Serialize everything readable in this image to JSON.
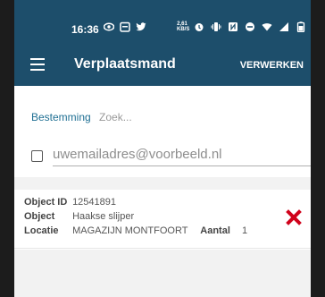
{
  "status_bar": {
    "time": "16:36",
    "network_speed": "2,61"
  },
  "app_bar": {
    "title": "Verplaatsmand",
    "process_label": "VERWERKEN",
    "menu_icon": "hamburger-menu-icon"
  },
  "destination": {
    "label": "Bestemming",
    "search_placeholder": "Zoek..."
  },
  "email": {
    "placeholder": "uwemailadres@voorbeeld.nl",
    "checked": false
  },
  "items": [
    {
      "object_id_label": "Object ID",
      "object_id": "12541891",
      "object_label": "Object",
      "object": "Haakse slijper",
      "location_label": "Locatie",
      "location": "MAGAZIJN MONTFOORT",
      "count_label": "Aantal",
      "count": "1"
    }
  ],
  "colors": {
    "app_bar": "#1d4e6b",
    "accent_label": "#1f6f93",
    "remove": "#d0021b"
  }
}
